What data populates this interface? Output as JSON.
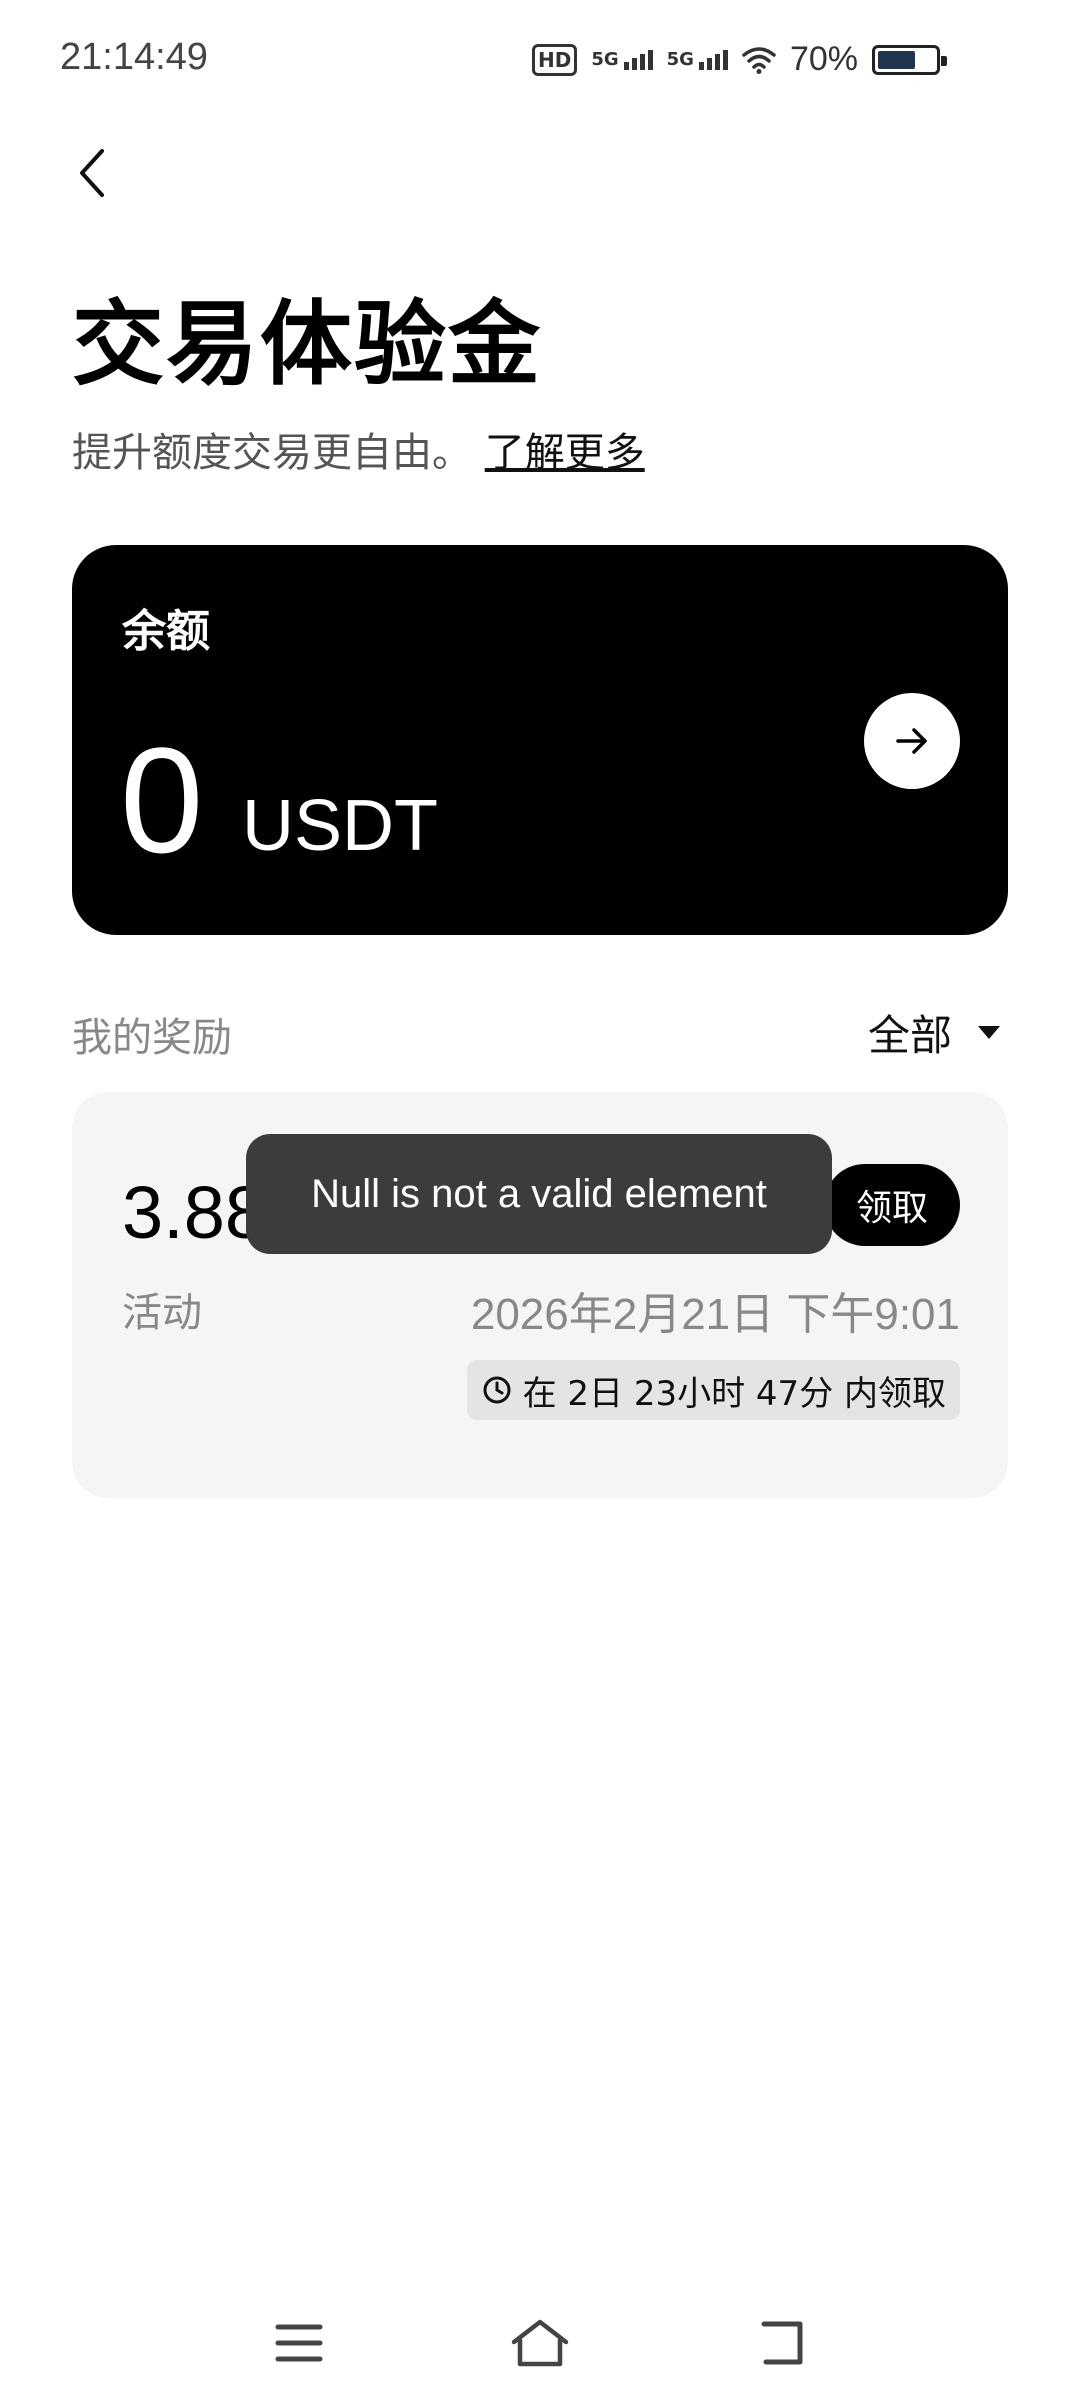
{
  "status_bar": {
    "time": "21:14:49",
    "hd_label": "HD",
    "sim1_label": "5G",
    "sim2_label": "5G",
    "battery_percent": "70%",
    "battery_level": 0.7
  },
  "header": {
    "title": "交易体验金",
    "subtitle": "提升额度交易更自由。",
    "learn_more": "了解更多"
  },
  "balance_card": {
    "label": "余额",
    "value": "0",
    "unit": "USDT"
  },
  "rewards": {
    "title": "我的奖励",
    "filter_label": "全部",
    "items": [
      {
        "amount": "3.88",
        "type": "活动",
        "date": "2026年2月21日 下午9:01",
        "countdown": "在 2日 23小时 47分 内领取",
        "claim_label": "领取"
      }
    ]
  },
  "toast": {
    "message": "Null is not a valid element"
  },
  "colors": {
    "card_black": "#000000",
    "reward_bg": "#f5f5f5",
    "toast_bg": "#3c3c3c",
    "muted_text": "#888888"
  }
}
